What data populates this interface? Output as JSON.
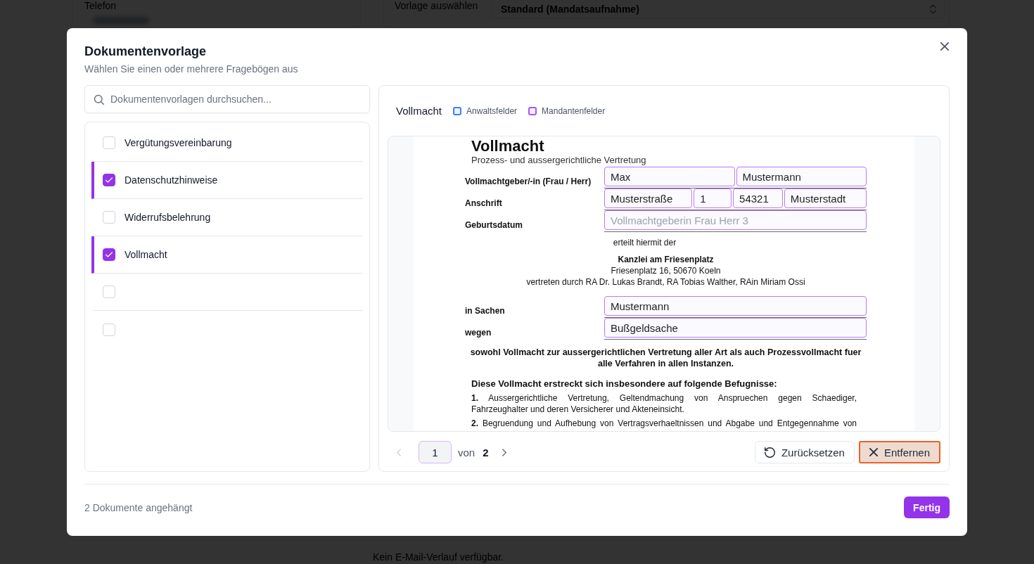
{
  "background": {
    "phone_label": "Telefon",
    "template_label": "Vorlage auswählen",
    "template_value": "Standard (Mandatsaufnahme)",
    "email_empty": "Kein E-Mail-Verlauf verfügbar."
  },
  "dialog": {
    "title": "Dokumentenvorlage",
    "subtitle": "Wählen Sie einen oder mehrere Fragebögen aus"
  },
  "search": {
    "placeholder": "Dokumentenvorlagen durchsuchen..."
  },
  "templates": [
    {
      "label": "Vergütungsvereinbarung",
      "checked": false
    },
    {
      "label": "Datenschutzhinweise",
      "checked": true
    },
    {
      "label": "Widerrufsbelehrung",
      "checked": false
    },
    {
      "label": "Vollmacht",
      "checked": true
    },
    {
      "checked": false
    },
    {
      "checked": false
    }
  ],
  "preview": {
    "title": "Vollmacht",
    "legend": [
      {
        "label": "Anwaltsfelder",
        "color": "#3b82f6"
      },
      {
        "label": "Mandantenfelder",
        "color": "#a855f7"
      }
    ],
    "document": {
      "title": "Vollmacht",
      "subtitle": "Prozess- und aussergerichtliche Vertretung",
      "rows": [
        {
          "label": "Vollmachtgeber/-in (Frau / Herr)",
          "fields": [
            {
              "value": "Max",
              "kind": "mandant"
            },
            {
              "value": "Mustermann",
              "kind": "mandant"
            }
          ]
        },
        {
          "label": "Anschrift",
          "fields": [
            {
              "value": "Musterstraße",
              "kind": "mandant"
            },
            {
              "value": "1",
              "kind": "mandant"
            },
            {
              "value": "54321",
              "kind": "mandant"
            },
            {
              "value": "Musterstadt",
              "kind": "mandant"
            }
          ]
        },
        {
          "label": "Geburtsdatum",
          "fields": [
            {
              "placeholder": "Vollmachtgeberin Frau Herr 3",
              "kind": "mandant"
            }
          ]
        }
      ],
      "grant": "erteilt hiermit der",
      "firm": {
        "name": "Kanzlei am Friesenplatz",
        "address": "Friesenplatz 16, 50670 Koeln",
        "representatives": "vertreten durch RA Dr. Lukas Brandt, RA Tobias Walther, RAin Miriam Ossi"
      },
      "case_rows": [
        {
          "label": "in Sachen",
          "fields": [
            {
              "value": "Mustermann",
              "kind": "mandant"
            }
          ]
        },
        {
          "label": "wegen",
          "fields": [
            {
              "value": "Bußgeldsache",
              "kind": "mandant"
            }
          ]
        }
      ],
      "scope": "sowohl Vollmacht zur aussergerichtlichen Vertretung aller Art als auch Prozessvollmacht fuer alle Verfahren in allen Instanzen.",
      "powers_heading": "Diese Vollmacht erstreckt sich insbesondere auf folgende Befugnisse:",
      "powers": [
        "**1.** Aussergerichtliche Vertretung, Geltendmachung von Anspruechen gegen Schaediger, Fahrzeughalter und deren Versicherer und Akteneinsicht.",
        "**2.** Begruendung und Aufhebung von Vertragsverhaeltnissen und Abgabe und Entgegennahme von"
      ]
    },
    "pagination": {
      "page": "1",
      "of_label": "von",
      "total": "2",
      "prev_disabled": true,
      "next_disabled": false
    },
    "actions": [
      {
        "label": "Zurücksetzen",
        "kind": "reset"
      },
      {
        "label": "Entfernen",
        "kind": "remove"
      }
    ]
  },
  "footer": {
    "status": "2 Dokumente angehängt",
    "done_button": "Fertig"
  }
}
